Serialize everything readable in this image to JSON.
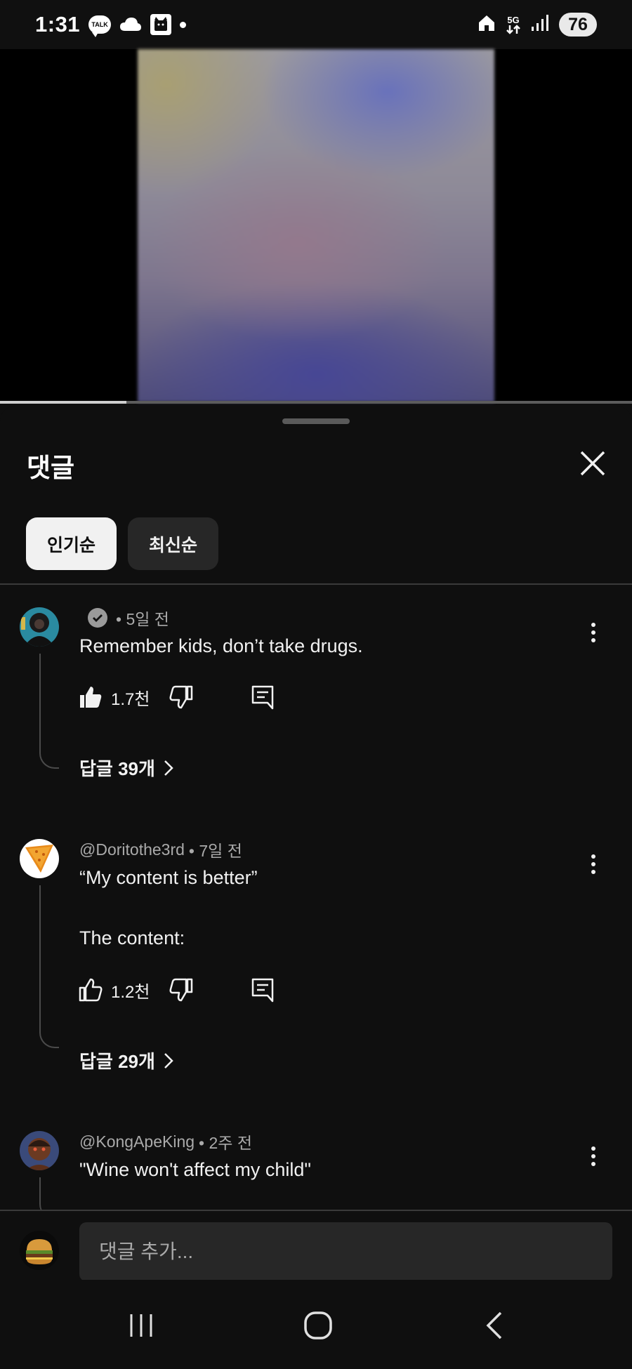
{
  "status_bar": {
    "time": "1:31",
    "talk_badge": "TALK",
    "network": "5G",
    "battery": "76"
  },
  "video": {
    "progress": 0.2
  },
  "comments_sheet": {
    "title": "댓글",
    "chips": [
      {
        "label": "인기순",
        "selected": true
      },
      {
        "label": "최신순",
        "selected": false
      }
    ],
    "comments": [
      {
        "author": "",
        "verified": true,
        "time": "• 5일 전",
        "lines": [
          "Remember kids, don’t take drugs."
        ],
        "likes": "1.7천",
        "liked": true,
        "replies_label": "답글 39개"
      },
      {
        "author": "@Doritothe3rd",
        "verified": false,
        "time": "• 7일 전",
        "lines": [
          "“My content is better”",
          "",
          "The content:"
        ],
        "likes": "1.2천",
        "liked": false,
        "replies_label": "답글 29개"
      },
      {
        "author": "@KongApeKing",
        "verified": false,
        "time": "• 2주 전",
        "lines": [
          "\"Wine won't affect my child\""
        ]
      }
    ]
  },
  "comment_input": {
    "placeholder": "댓글 추가..."
  },
  "colors": {
    "background": "#0f0f0f",
    "chip_selected": "#f1f1f1",
    "chip_normal": "#272727",
    "meta_text": "#aaaaaa"
  },
  "icons": [
    "talk-icon",
    "cloud-icon",
    "app-icon",
    "home-icon",
    "signal-icon",
    "close-icon",
    "verified-icon",
    "like-icon",
    "dislike-icon",
    "reply-icon",
    "more-icon",
    "chevron-right-icon",
    "recents-icon",
    "home-nav-icon",
    "back-icon"
  ]
}
